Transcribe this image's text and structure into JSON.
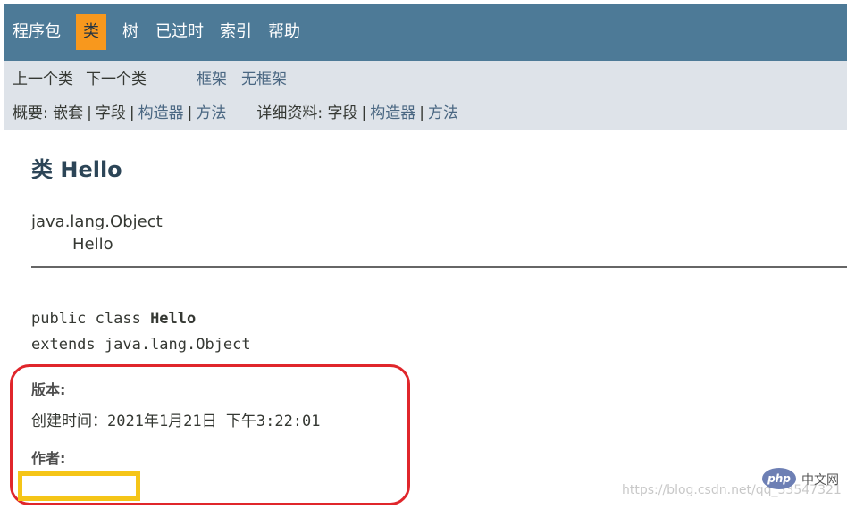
{
  "topnav": {
    "items": [
      {
        "label": "程序包",
        "active": false
      },
      {
        "label": "类",
        "active": true
      },
      {
        "label": "树",
        "active": false
      },
      {
        "label": "已过时",
        "active": false
      },
      {
        "label": "索引",
        "active": false
      },
      {
        "label": "帮助",
        "active": false
      }
    ]
  },
  "subnav": {
    "prev_class": "上一个类",
    "next_class": "下一个类",
    "frames": "框架",
    "no_frames": "无框架",
    "summary_label": "概要:",
    "summary_nested": "嵌套",
    "summary_field": "字段",
    "summary_constructor": "构造器",
    "summary_method": "方法",
    "detail_label": "详细资料:",
    "detail_field": "字段",
    "detail_constructor": "构造器",
    "detail_method": "方法",
    "separator": "|"
  },
  "header": {
    "title": "类 Hello"
  },
  "inheritance": {
    "parent": "java.lang.Object",
    "child": "Hello"
  },
  "signature": {
    "line1_prefix": "public class ",
    "line1_name": "Hello",
    "line2": "extends java.lang.Object"
  },
  "tags": {
    "version_label": "版本:",
    "version_value": "创建时间：2021年1月21日 下午3:22:01",
    "author_label": "作者:"
  },
  "watermark": {
    "text": "https://blog.csdn.net/qq_33547321",
    "logo": "php",
    "logo_text": "中文网"
  },
  "colors": {
    "topnav_bg": "#4d7a97",
    "active_tab_bg": "#f8981d",
    "subnav_bg": "#dee3e9",
    "link": "#4a6782",
    "annotation_red": "#e0262b",
    "annotation_yellow": "#f5c518"
  }
}
